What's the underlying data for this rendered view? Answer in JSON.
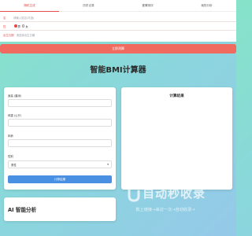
{
  "tabs": [
    {
      "label": "随机生成",
      "active": true
    },
    {
      "label": "历史记录",
      "active": false
    },
    {
      "label": "爱情测评",
      "active": false
    },
    {
      "label": "我的分析",
      "active": false
    }
  ],
  "form": {
    "name_label": "名",
    "name_placeholder": "请输入姓名(可选)",
    "gender_label": "性",
    "gender_options": [
      "男",
      "女"
    ],
    "birth_label": "出生日期",
    "birth_placeholder": "请选择出生日期"
  },
  "start_button": "立即测算",
  "page_title": "智能BMI计算器",
  "calculator": {
    "height_label": "身高 (厘米)",
    "weight_label": "体重 (公斤)",
    "age_label": "年龄",
    "gender_label": "性别",
    "gender_value": "男性",
    "calc_button": "计算结果"
  },
  "result": {
    "title": "计算结果"
  },
  "ai_section": {
    "title": "AI 智能分析"
  },
  "watermark": {
    "brand": "自动秒收录",
    "slogan": "数上链接→来访一次→自动收录→"
  },
  "colors": {
    "accent": "#e64b4b",
    "button_blue": "#4a90e2",
    "start_button": "#f06a60"
  }
}
